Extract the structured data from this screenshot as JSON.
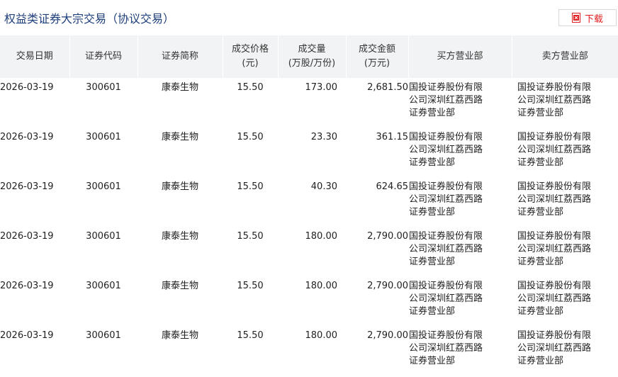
{
  "header": {
    "title": "权益类证券大宗交易（协议交易）",
    "download_label": "下载"
  },
  "colors": {
    "accent": "#e02020",
    "title": "#1f3f7a",
    "header_bg": "#f2f3f5"
  },
  "table": {
    "columns": [
      {
        "line1": "交易日期",
        "line2": ""
      },
      {
        "line1": "证券代码",
        "line2": ""
      },
      {
        "line1": "证券简称",
        "line2": ""
      },
      {
        "line1": "成交价格",
        "line2": "(元)"
      },
      {
        "line1": "成交量",
        "line2": "(万股/万份)"
      },
      {
        "line1": "成交金额",
        "line2": "(万元)"
      },
      {
        "line1": "买方营业部",
        "line2": ""
      },
      {
        "line1": "卖方营业部",
        "line2": ""
      }
    ],
    "rows": [
      {
        "date": "2026-03-19",
        "code": "300601",
        "name": "康泰生物",
        "price": "15.50",
        "volume": "173.00",
        "amount": "2,681.50",
        "buyer": "国投证券股份有限公司深圳红荔西路证券营业部",
        "seller": "国投证券股份有限公司深圳红荔西路证券营业部"
      },
      {
        "date": "2026-03-19",
        "code": "300601",
        "name": "康泰生物",
        "price": "15.50",
        "volume": "23.30",
        "amount": "361.15",
        "buyer": "国投证券股份有限公司深圳红荔西路证券营业部",
        "seller": "国投证券股份有限公司深圳红荔西路证券营业部"
      },
      {
        "date": "2026-03-19",
        "code": "300601",
        "name": "康泰生物",
        "price": "15.50",
        "volume": "40.30",
        "amount": "624.65",
        "buyer": "国投证券股份有限公司深圳红荔西路证券营业部",
        "seller": "国投证券股份有限公司深圳红荔西路证券营业部"
      },
      {
        "date": "2026-03-19",
        "code": "300601",
        "name": "康泰生物",
        "price": "15.50",
        "volume": "180.00",
        "amount": "2,790.00",
        "buyer": "国投证券股份有限公司深圳红荔西路证券营业部",
        "seller": "国投证券股份有限公司深圳红荔西路证券营业部"
      },
      {
        "date": "2026-03-19",
        "code": "300601",
        "name": "康泰生物",
        "price": "15.50",
        "volume": "180.00",
        "amount": "2,790.00",
        "buyer": "国投证券股份有限公司深圳红荔西路证券营业部",
        "seller": "国投证券股份有限公司深圳红荔西路证券营业部"
      },
      {
        "date": "2026-03-19",
        "code": "300601",
        "name": "康泰生物",
        "price": "15.50",
        "volume": "180.00",
        "amount": "2,790.00",
        "buyer": "国投证券股份有限公司深圳红荔西路证券营业部",
        "seller": "国投证券股份有限公司深圳红荔西路证券营业部"
      }
    ]
  }
}
